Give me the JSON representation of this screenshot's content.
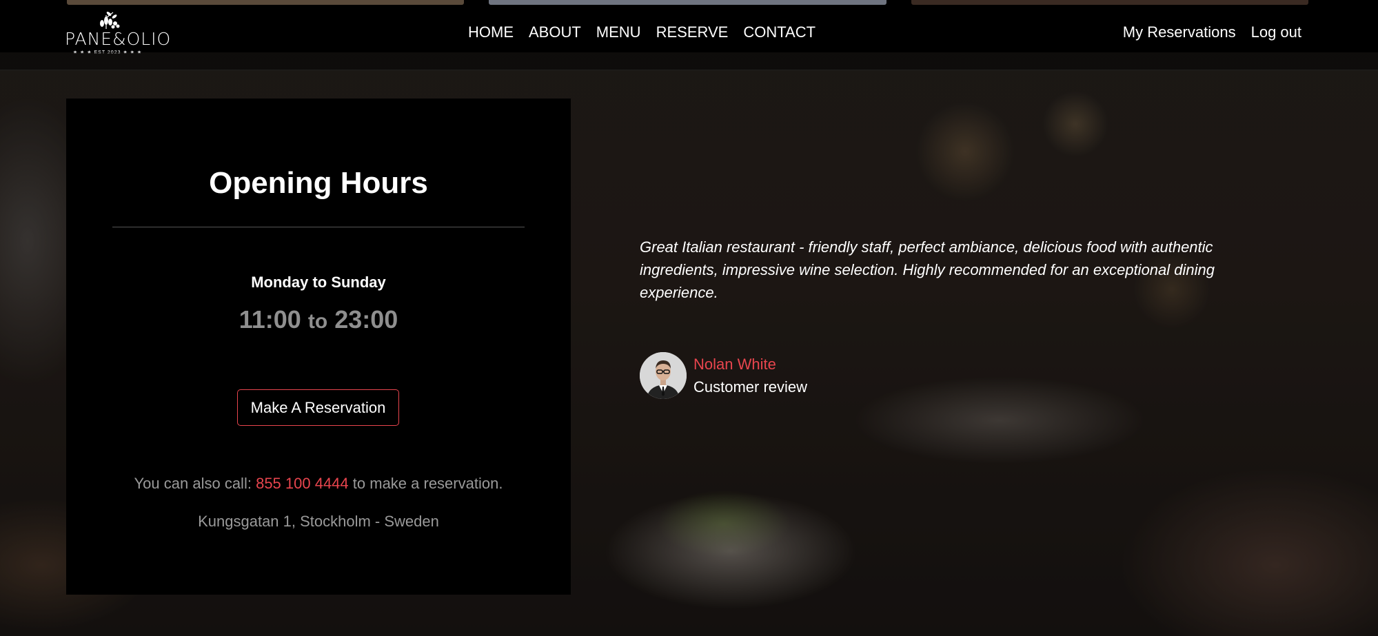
{
  "brand": {
    "name": "PANE&OLIO",
    "tagline": "EST 2023",
    "accent_color": "#e8454e"
  },
  "nav": {
    "links": [
      {
        "label": "HOME"
      },
      {
        "label": "ABOUT"
      },
      {
        "label": "MENU"
      },
      {
        "label": "RESERVE"
      },
      {
        "label": "CONTACT"
      }
    ],
    "right": [
      {
        "label": "My Reservations"
      },
      {
        "label": "Log out"
      }
    ]
  },
  "hours": {
    "title": "Opening Hours",
    "days": "Monday to Sunday",
    "open": "11:00",
    "separator": "to",
    "close": "23:00",
    "button_label": "Make A Reservation",
    "call_prefix": "You can also call:",
    "phone": "855 100 4444",
    "call_suffix": "to make a reservation.",
    "address": "Kungsgatan 1, Stockholm - Sweden"
  },
  "review": {
    "quote": "Great Italian restaurant - friendly staff, perfect ambiance, delicious food with authentic ingredients, impressive wine selection. Highly recommended for an exceptional dining experience.",
    "name": "Nolan White",
    "role": "Customer review",
    "avatar_icon": "person-avatar-icon"
  }
}
